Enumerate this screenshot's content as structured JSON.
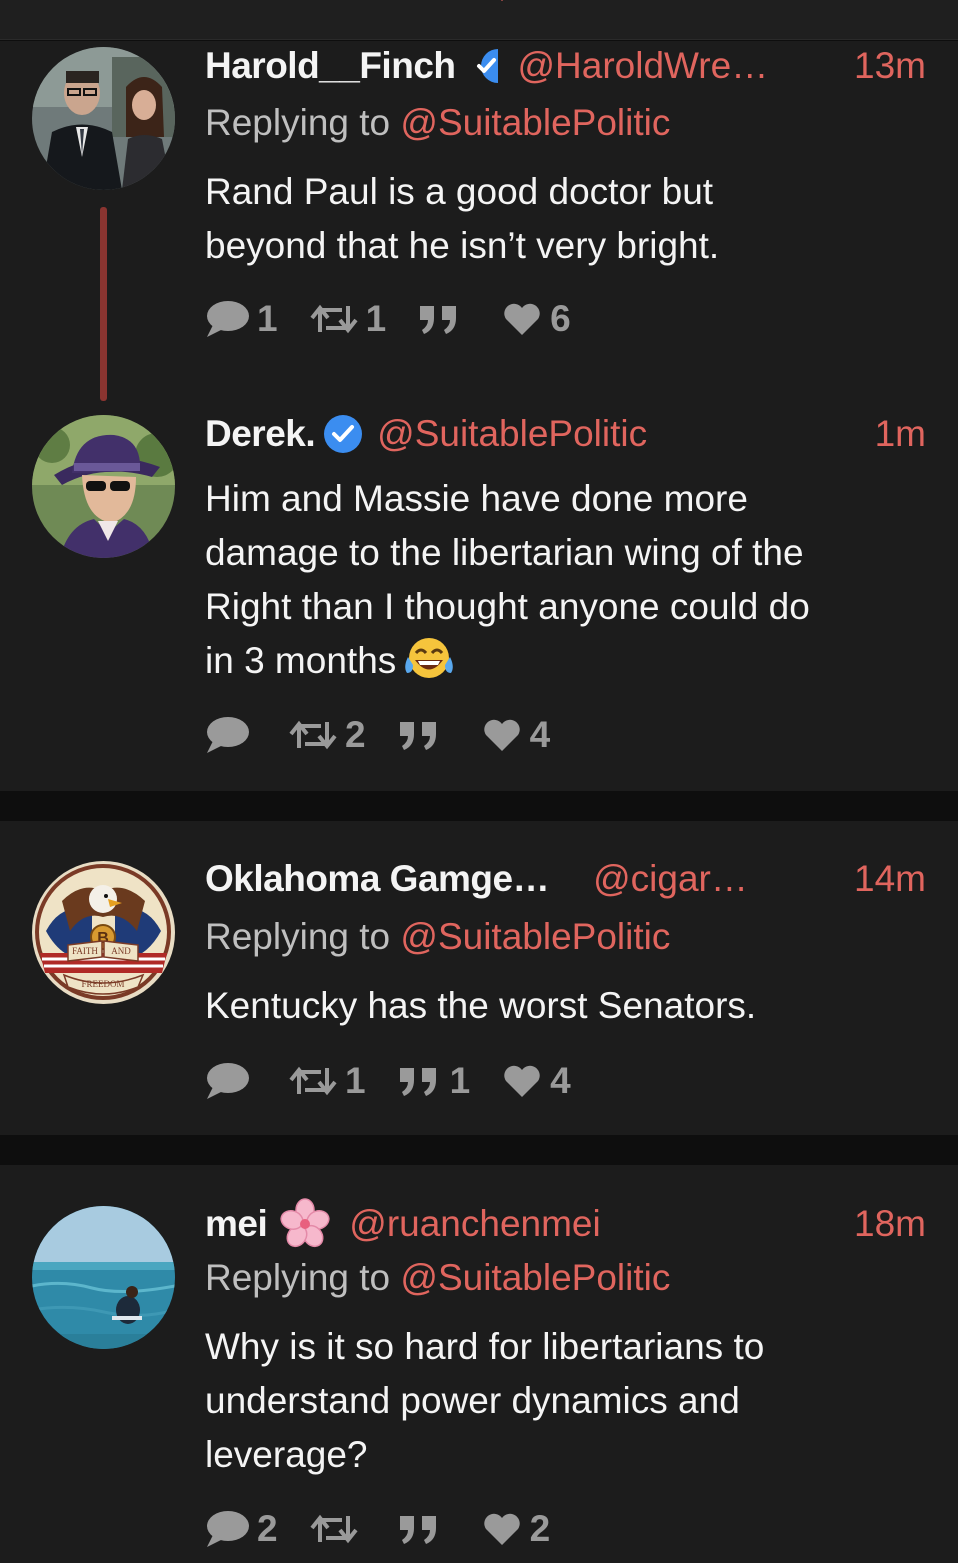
{
  "colors": {
    "background": "#0e0e0e",
    "card": "#1c1c1c",
    "accent": "#e0655e",
    "verified": "#3b8df0",
    "muted": "#9a9a9a",
    "thread_line": "#8a3430"
  },
  "tweets": [
    {
      "name": "Harold__Finch",
      "verified": true,
      "handle": "@HaroldWre…",
      "time": "13m",
      "replying_prefix": "Replying to ",
      "replying_handle": "@SuitablePolitic",
      "text_lines": [
        "Rand Paul is a good doctor but",
        "beyond that he isn’t very bright."
      ],
      "replies": "1",
      "retweets": "1",
      "quotes": "",
      "likes": "6",
      "avatar_icon": "two-people-photo"
    },
    {
      "name": "Derek.",
      "verified": true,
      "handle": "@SuitablePolitic",
      "time": "1m",
      "text_lines": [
        "Him and Massie have done more",
        "damage to the libertarian wing of the",
        "Right than I thought anyone could do",
        "in 3 months"
      ],
      "emoji": "tears-of-joy-emoji",
      "replies": "",
      "retweets": "2",
      "quotes": "",
      "likes": "4",
      "avatar_icon": "man-in-hat-drawing"
    },
    {
      "name": "Oklahoma Gamge…",
      "handle": "@cigar…",
      "time": "14m",
      "replying_prefix": "Replying to ",
      "replying_handle": "@SuitablePolitic",
      "text_lines": [
        "Kentucky has the worst Senators."
      ],
      "replies": "",
      "retweets": "1",
      "quotes": "1",
      "likes": "4",
      "avatar_icon": "eagle-faith-freedom-emblem",
      "avatar_text": [
        "FAITH",
        "AND",
        "FREEDOM",
        "B"
      ]
    },
    {
      "name": "mei",
      "name_emoji": "cherry-blossom-emoji",
      "handle": "@ruanchenmei",
      "time": "18m",
      "replying_prefix": "Replying to ",
      "replying_handle": "@SuitablePolitic",
      "text_lines": [
        "Why is it so hard for libertarians to",
        "understand power dynamics and",
        "leverage?"
      ],
      "replies": "2",
      "retweets": "",
      "quotes": "",
      "likes": "2",
      "avatar_icon": "person-swimming-sea-photo"
    }
  ]
}
